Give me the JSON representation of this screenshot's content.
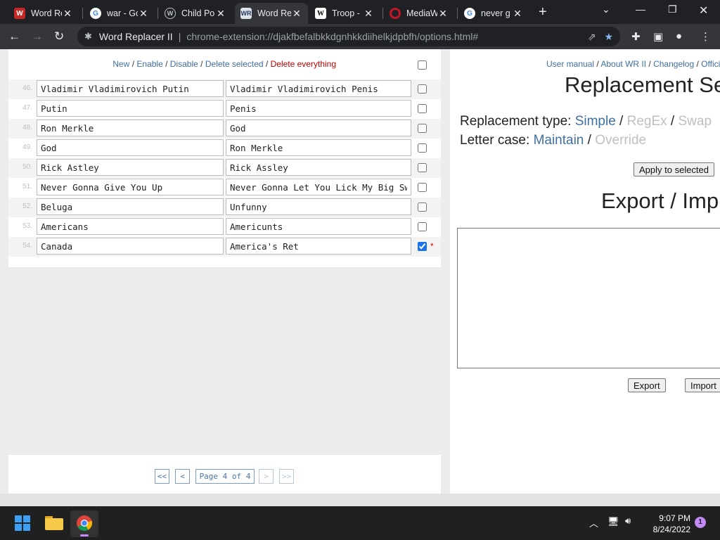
{
  "tabs": [
    {
      "title": "Word Re",
      "icon": "word-replacer-icon",
      "active": false
    },
    {
      "title": "war - Go",
      "icon": "google-icon",
      "active": false
    },
    {
      "title": "Child Po",
      "icon": "wordpress-icon",
      "active": false
    },
    {
      "title": "Word Re",
      "icon": "word-replacer-icon",
      "active": true
    },
    {
      "title": "Troop -",
      "icon": "wikipedia-icon",
      "active": false
    },
    {
      "title": "MediaW",
      "icon": "opera-icon",
      "active": false
    },
    {
      "title": "never g",
      "icon": "google-icon",
      "active": false
    }
  ],
  "omnibox": {
    "extension_name": "Word Replacer II",
    "url": "chrome-extension://djakfbefalbkkdgnhkkdiihelkjdpbfh/options.html#"
  },
  "left": {
    "actions": {
      "new": "New",
      "enable": "Enable",
      "disable": "Disable",
      "delete_selected": "Delete selected",
      "delete_everything": "Delete everything",
      "sep": "/"
    },
    "rows": [
      {
        "num": "46.",
        "find": "Vladimir Vladimirovich Putin",
        "replace": "Vladimir Vladimirovich Penis",
        "checked": false
      },
      {
        "num": "47.",
        "find": "Putin",
        "replace": "Penis",
        "checked": false
      },
      {
        "num": "48.",
        "find": "Ron Merkle",
        "replace": "God",
        "checked": false
      },
      {
        "num": "49.",
        "find": "God",
        "replace": "Ron Merkle",
        "checked": false
      },
      {
        "num": "50.",
        "find": "Rick Astley",
        "replace": "Rick Assley",
        "checked": false
      },
      {
        "num": "51.",
        "find": "Never Gonna Give You Up",
        "replace": "Never Gonna Let You Lick My Big Swe",
        "checked": false
      },
      {
        "num": "52.",
        "find": "Beluga",
        "replace": "Unfunny",
        "checked": false
      },
      {
        "num": "53.",
        "find": "Americans",
        "replace": "Americunts",
        "checked": false
      },
      {
        "num": "54.",
        "find": "Canada",
        "replace": "America's Ret",
        "checked": true,
        "modified": "*"
      }
    ],
    "pager": {
      "first": "<<",
      "prev": "<",
      "page_label": "Page 4 of 4",
      "next": ">",
      "last": ">>"
    }
  },
  "right": {
    "links": {
      "manual": "User manual",
      "about": "About WR II",
      "changelog": "Changelog",
      "official": "Offici"
    },
    "replacement_settings_heading": "Replacement Se",
    "replacement_type": {
      "label": "Replacement type:",
      "simple": "Simple",
      "regex": "RegEx",
      "swap": "Swap"
    },
    "letter_case": {
      "label": "Letter case:",
      "maintain": "Maintain",
      "override": "Override"
    },
    "apply_selected": "Apply to selected",
    "export_import_heading": "Export / Imp",
    "export_button": "Export",
    "import_button": "Import"
  },
  "taskbar": {
    "time": "9:07 PM",
    "date": "8/24/2022",
    "notification_count": "1"
  },
  "colors": {
    "link": "#3f6fa3",
    "danger": "#c00000",
    "disabled_option": "#bfbfbf",
    "checkbox_accent": "#1a73e8"
  }
}
